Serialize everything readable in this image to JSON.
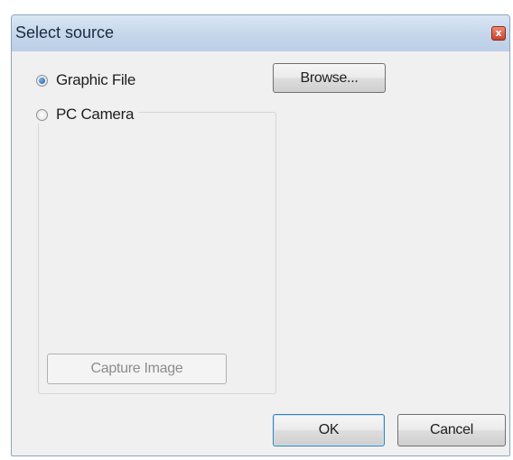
{
  "window": {
    "title": "Select source",
    "close_label": "x"
  },
  "source": {
    "graphic_file_label": "Graphic File",
    "graphic_file_selected": true,
    "pc_camera_label": "PC Camera",
    "pc_camera_selected": false
  },
  "buttons": {
    "browse_label": "Browse...",
    "capture_label": "Capture Image",
    "ok_label": "OK",
    "cancel_label": "Cancel"
  }
}
